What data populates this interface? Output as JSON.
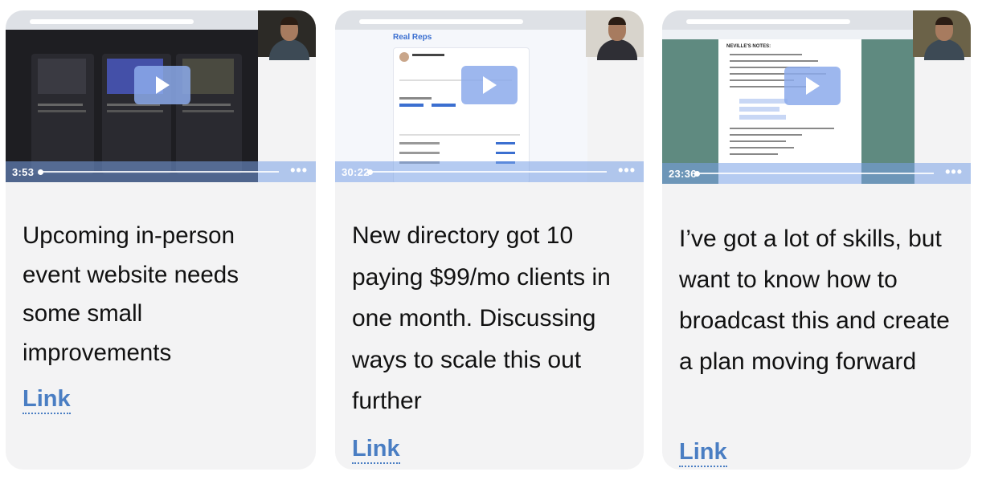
{
  "cards": [
    {
      "video": {
        "duration": "3:53"
      },
      "description": "Upcoming in-person event website needs some small improvements",
      "link_label": "Link"
    },
    {
      "video": {
        "duration": "30:22",
        "slide_title": "Real Reps"
      },
      "description": "New directory got 10 paying $99/mo clients in one month. Discussing ways to scale this out further",
      "link_label": "Link"
    },
    {
      "video": {
        "duration": "23:36",
        "doc_heading": "NEVILLE'S NOTES:"
      },
      "description": "I’ve got a lot of skills, but want to know how to broadcast this and create a plan moving forward",
      "link_label": "Link"
    }
  ],
  "colors": {
    "link": "#4a7ec3",
    "card_bg": "#f3f3f4",
    "player_bar": "#78a0e6"
  }
}
